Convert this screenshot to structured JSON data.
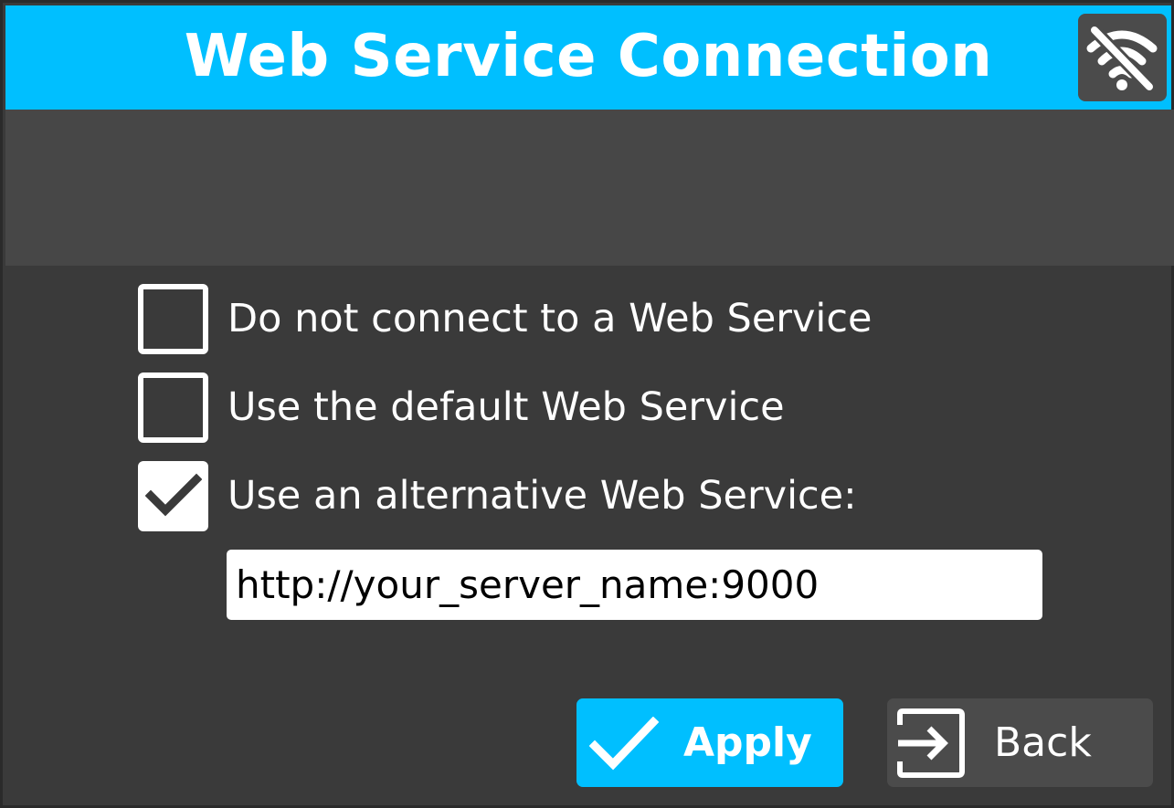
{
  "dialog": {
    "title": "Web Service Connection",
    "status_icon": "wifi-off-icon"
  },
  "options": [
    {
      "label": "Do not connect to a Web Service",
      "checked": false
    },
    {
      "label": "Use the default Web Service",
      "checked": false
    },
    {
      "label": "Use an alternative Web Service:",
      "checked": true
    }
  ],
  "alt_service": {
    "url_value": "http://your_server_name:9000"
  },
  "footer": {
    "apply_label": "Apply",
    "apply_icon": "checkmark-icon",
    "back_label": "Back",
    "back_icon": "exit-icon"
  },
  "colors": {
    "accent": "#00bfff",
    "panel": "#3a3a3a",
    "band": "#474747",
    "button_dark": "#4b4b4b"
  }
}
